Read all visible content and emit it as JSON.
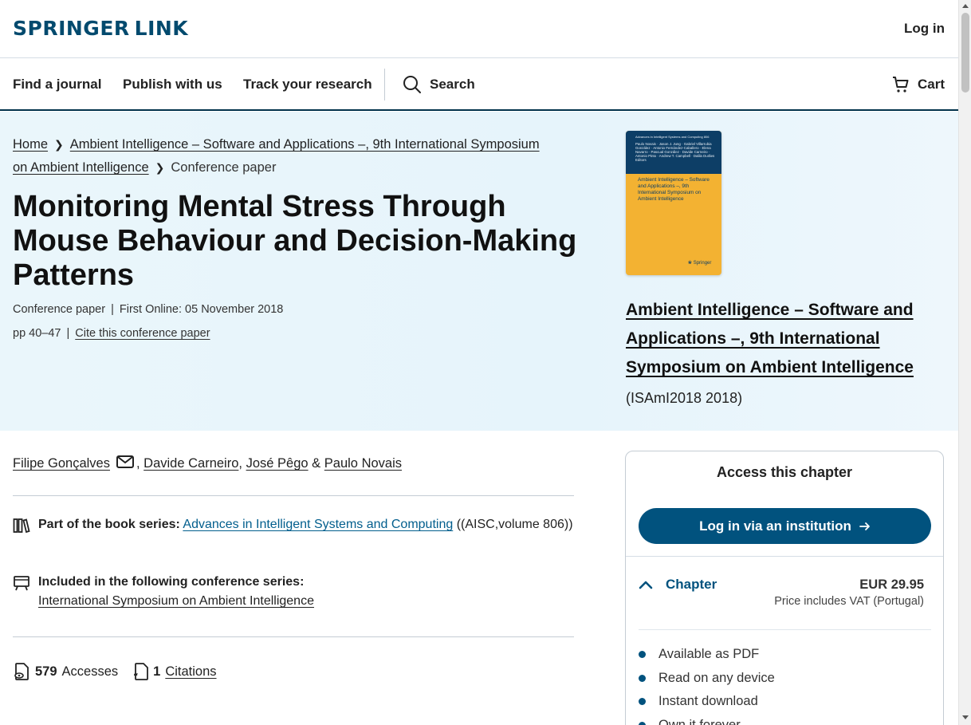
{
  "header": {
    "logo_word1": "SPRINGER",
    "logo_word2": "LINK",
    "login": "Log in"
  },
  "nav": {
    "items": [
      "Find a journal",
      "Publish with us",
      "Track your research"
    ],
    "search": "Search",
    "cart": "Cart"
  },
  "breadcrumb": {
    "home": "Home",
    "book_line1": "Ambient Intelligence – Software and Applications –, 9th International Symposium",
    "book_line2": "on Ambient Intelligence",
    "current": "Conference paper"
  },
  "article": {
    "title": "Monitoring Mental Stress Through Mouse Behaviour and Decision-Making Patterns",
    "type": "Conference paper",
    "first_online": "First Online: 05 November 2018",
    "pages": "pp 40–47",
    "cite": "Cite this conference paper"
  },
  "book": {
    "cover_series": "Advances in Intelligent Systems and Computing 806",
    "cover_authors": "Paulo Novais · Jason J. Jung · Gabriel Villarrubia González · Antonio Fernández-Caballero · Elena Navarro · Pascual González · Davide Carneiro · Antonio Pinto · Andrew T. Campbell · Dalila Durães Editors",
    "cover_title": "Ambient Intelligence – Software and Applications –, 9th International Symposium on Ambient Intelligence",
    "cover_publisher": "Springer",
    "title": "Ambient Intelligence – Software and Applications –, 9th International Symposium on Ambient Intelligence",
    "subtitle": "(ISAmI2018 2018)"
  },
  "authors": {
    "a1": "Filipe Gonçalves",
    "a2": "Davide Carneiro",
    "a3": "José Pêgo",
    "a4": "Paulo Novais",
    "comma": ",",
    "amp": "&"
  },
  "series": {
    "label": "Part of the book series:",
    "link": "Advances in Intelligent Systems and Computing",
    "suffix": "((AISC,volume 806))",
    "conf_label": "Included in the following conference series:",
    "conf_link": "International Symposium on Ambient Intelligence"
  },
  "metrics": {
    "accesses_num": "579",
    "accesses_label": "Accesses",
    "citations_num": "1",
    "citations_label": "Citations"
  },
  "access": {
    "heading": "Access this chapter",
    "institution_button": "Log in via an institution",
    "chapter_label": "Chapter",
    "price": "EUR 29.95",
    "vat": "Price includes VAT (Portugal)",
    "features": [
      "Available as PDF",
      "Read on any device",
      "Instant download",
      "Own it forever"
    ]
  }
}
